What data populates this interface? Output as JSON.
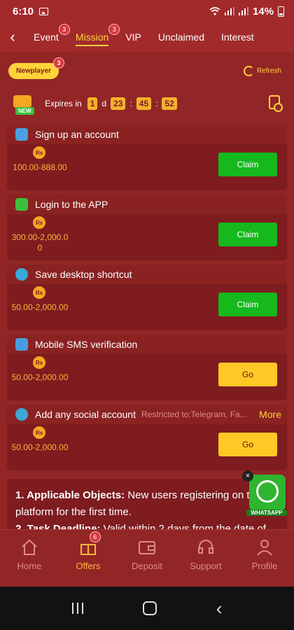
{
  "status_bar": {
    "time": "6:10",
    "battery": "14%"
  },
  "tabs": [
    {
      "label": "Event",
      "badge": "3",
      "active": false
    },
    {
      "label": "Mission",
      "badge": "3",
      "active": true
    },
    {
      "label": "VIP",
      "badge": "",
      "active": false
    },
    {
      "label": "Unclaimed",
      "badge": "",
      "active": false
    },
    {
      "label": "Interest",
      "badge": "",
      "active": false
    }
  ],
  "filter": {
    "label": "Newplayer",
    "badge": "3",
    "refresh_label": "Refresh"
  },
  "expiry": {
    "badge_label": "NEW",
    "label": "Expires in",
    "days": "1",
    "days_unit": "d",
    "hours": "23",
    "minutes": "45",
    "seconds": "52",
    "sep": ":"
  },
  "currency_symbol": "Rs",
  "tasks": [
    {
      "title": "Sign up an account",
      "amount": "100.00-888.00",
      "button": "Claim",
      "icon": "phone-check-icon",
      "icon_color": "#4aa0e0"
    },
    {
      "title": "Login to the APP",
      "amount": "300.00-2,000.00",
      "button": "Claim",
      "icon": "app-login-icon",
      "icon_color": "#3fbf3f"
    },
    {
      "title": "Save desktop shortcut",
      "amount": "50.00-2,000.00",
      "button": "Claim",
      "icon": "globe-icon",
      "icon_color": "#38a8d8"
    },
    {
      "title": "Mobile SMS verification",
      "amount": "50.00-2,000.00",
      "button": "Go",
      "icon": "sms-phone-icon",
      "icon_color": "#4a9be0"
    },
    {
      "title": "Add any social account",
      "restriction": "Restricted to:Telegram, Fa...",
      "more": "More",
      "amount": "50.00-2,000.00",
      "button": "Go",
      "icon": "social-icon",
      "icon_color": "#3fa7d8"
    }
  ],
  "rules": {
    "item1_title": "1. Applicable Objects:",
    "item1_text": " New users registering on the platform for the first time.",
    "item2_title": "2. Task Deadline:",
    "item2_text": " Valid within 2 days from the date of"
  },
  "whatsapp": {
    "label": "WHATSAPP",
    "close": "×"
  },
  "bottom_nav": [
    {
      "label": "Home",
      "badge": "",
      "active": false,
      "icon": "home-icon"
    },
    {
      "label": "Offers",
      "badge": "6",
      "active": true,
      "icon": "gift-box-icon"
    },
    {
      "label": "Deposit",
      "badge": "",
      "active": false,
      "icon": "wallet-icon"
    },
    {
      "label": "Support",
      "badge": "",
      "active": false,
      "icon": "headset-icon"
    },
    {
      "label": "Profile",
      "badge": "",
      "active": false,
      "icon": "person-icon"
    }
  ],
  "colors": {
    "accent": "#ffd23b",
    "claim": "#15b91d",
    "go": "#ffc825",
    "bg": "#922626"
  }
}
